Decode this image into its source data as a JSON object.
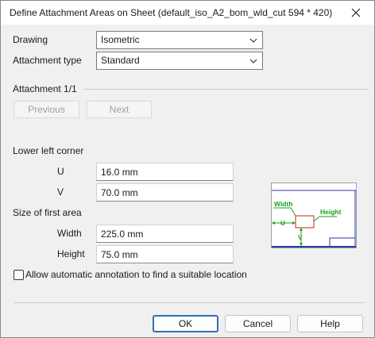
{
  "window": {
    "title": "Define Attachment Areas on Sheet  (default_iso_A2_bom_wld_cut 594 * 420)",
    "close_icon": "close-icon"
  },
  "drawing": {
    "label": "Drawing",
    "value": "Isometric"
  },
  "attachment_type": {
    "label": "Attachment type",
    "value": "Standard"
  },
  "attachment": {
    "label": "Attachment 1/1",
    "previous_label": "Previous",
    "next_label": "Next"
  },
  "lower_left_corner": {
    "label": "Lower left corner",
    "u_label": "U",
    "u_value": "16.0 mm",
    "v_label": "V",
    "v_value": "70.0 mm"
  },
  "first_area": {
    "label": "Size of first area",
    "width_label": "Width",
    "width_value": "225.0 mm",
    "height_label": "Height",
    "height_value": "75.0 mm"
  },
  "diagram": {
    "width_label": "Width",
    "height_label": "Height",
    "u_label": "U",
    "v_label": "V",
    "label_color": "#1aa01a",
    "rect_color": "#cc2222",
    "frame_color": "#2a3aa0"
  },
  "auto_annotation": {
    "label": "Allow automatic annotation to find a suitable location",
    "checked": false
  },
  "buttons": {
    "ok": "OK",
    "cancel": "Cancel",
    "help": "Help"
  },
  "colors": {
    "accent": "#2f6fb8"
  }
}
